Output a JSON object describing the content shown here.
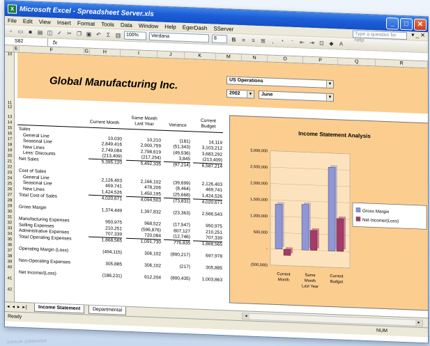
{
  "window": {
    "title": "Microsoft Excel - Spreadsheet Server.xls",
    "app_icon": "excel-icon",
    "btn_min": "_",
    "btn_max": "□",
    "btn_close": "✕"
  },
  "menu": {
    "items": [
      "File",
      "Edit",
      "View",
      "Insert",
      "Format",
      "Tools",
      "Data",
      "Window",
      "Help",
      "EgerDash",
      "SServer"
    ],
    "help_placeholder": "Type a question for help",
    "doc_close": "▾ _ ✕"
  },
  "toolbar": {
    "zoom": "100%",
    "font": "Verdana",
    "font_size": "8",
    "bold": "B"
  },
  "formula_bar": {
    "name_box": "S82",
    "fx": "fx"
  },
  "columns": [
    "E",
    "F",
    "G",
    "H",
    "I",
    "J",
    "K",
    "M",
    "N",
    "O",
    "P",
    "Q",
    "R"
  ],
  "rows": [
    "10",
    "11",
    "12",
    "13",
    "14",
    "15",
    "16",
    "17",
    "18",
    "19",
    "20",
    "21",
    "22",
    "23",
    "24",
    "25",
    "26",
    "27",
    "28",
    "29",
    "30",
    "31",
    "32",
    "33",
    "34",
    "35",
    "36",
    "37",
    "38",
    "39",
    "40",
    "41",
    "42"
  ],
  "header": {
    "company": "Global Manufacturing Inc.",
    "region": "US Operations",
    "year": "2002",
    "month": "June"
  },
  "table": {
    "headers": {
      "current_month": "Current Month",
      "same_month": "Same Month",
      "last_year": "Last Year",
      "variance": "Variance",
      "current": "Current",
      "budget": "Budget"
    },
    "rows": [
      {
        "label": "Sales",
        "indent": false,
        "v": [
          "",
          "",
          "",
          ""
        ],
        "ul": false
      },
      {
        "label": "General Line",
        "indent": true,
        "v": [
          "10,030",
          "10,210",
          "(181)",
          "14,119"
        ],
        "ul": false
      },
      {
        "label": "Seasonal Line",
        "indent": true,
        "v": [
          "2,849,416",
          "2,900,759",
          "(51,343)",
          "3,103,212"
        ],
        "ul": false
      },
      {
        "label": "New Lines",
        "indent": true,
        "v": [
          "2,749,084",
          "2,798,619",
          "(49,536)",
          "3,683,292"
        ],
        "ul": false
      },
      {
        "label": "Less: Discounts",
        "indent": true,
        "v": [
          "(213,409)",
          "(217,254)",
          "3,845",
          "(213,409)"
        ],
        "ul": true
      },
      {
        "label": "Net Sales",
        "indent": false,
        "v": [
          "5,395,120",
          "5,492,335",
          "(97,214)",
          "6,587,214"
        ],
        "ul": false
      },
      {
        "label": "",
        "indent": false,
        "v": [
          "",
          "",
          "",
          ""
        ],
        "ul": false
      },
      {
        "label": "Cost of Sales",
        "indent": false,
        "v": [
          "",
          "",
          "",
          ""
        ],
        "ul": false
      },
      {
        "label": "General Line",
        "indent": true,
        "v": [
          "2,126,403",
          "2,166,102",
          "(39,699)",
          "2,126,403"
        ],
        "ul": false
      },
      {
        "label": "Seasonal Line",
        "indent": true,
        "v": [
          "469,741",
          "478,206",
          "(8,464)",
          "469,741"
        ],
        "ul": false
      },
      {
        "label": "New Lines",
        "indent": true,
        "v": [
          "1,424,526",
          "1,450,195",
          "(25,668)",
          "1,424,526"
        ],
        "ul": true
      },
      {
        "label": "Total Cost of Sales",
        "indent": false,
        "v": [
          "4,020,671",
          "4,094,503",
          "(73,831)",
          "4,020,671"
        ],
        "ul": false
      },
      {
        "label": "",
        "indent": false,
        "v": [
          "",
          "",
          "",
          ""
        ],
        "ul": false
      },
      {
        "label": "Gross Margin",
        "indent": false,
        "v": [
          "1,374,449",
          "1,397,832",
          "(23,363)",
          "2,566,543"
        ],
        "ul": false
      },
      {
        "label": "",
        "indent": false,
        "v": [
          "",
          "",
          "",
          ""
        ],
        "ul": false
      },
      {
        "label": "Manufacturing Expenses",
        "indent": false,
        "v": [
          "950,975",
          "968,522",
          "(17,547)",
          "950,975"
        ],
        "ul": false
      },
      {
        "label": "Selling Expenses",
        "indent": false,
        "v": [
          "210,251",
          "(596,876)",
          "807,127",
          "210,251"
        ],
        "ul": false
      },
      {
        "label": "Administrative Expenses",
        "indent": false,
        "v": [
          "707,339",
          "720,084",
          "(12,746)",
          "707,339"
        ],
        "ul": true
      },
      {
        "label": "Total Operating Expenses",
        "indent": false,
        "v": [
          "1,868,565",
          "1,091,730",
          "776,835",
          "1,868,565"
        ],
        "ul": false
      },
      {
        "label": "",
        "indent": false,
        "v": [
          "",
          "",
          "",
          ""
        ],
        "ul": false
      },
      {
        "label": "Operating Margin (Loss)",
        "indent": false,
        "v": [
          "(494,115)",
          "306,102",
          "(800,217)",
          "697,978"
        ],
        "ul": false
      },
      {
        "label": "",
        "indent": false,
        "v": [
          "",
          "",
          "",
          ""
        ],
        "ul": false
      },
      {
        "label": "Non-Operating Expenses",
        "indent": false,
        "v": [
          "305,885",
          "306,102",
          "(217)",
          "305,885"
        ],
        "ul": false
      },
      {
        "label": "",
        "indent": false,
        "v": [
          "",
          "",
          "",
          ""
        ],
        "ul": false
      },
      {
        "label": "Net Income/(Loss)",
        "indent": false,
        "v": [
          "(188,231)",
          "612,204",
          "(800,435)",
          "1,003,863"
        ],
        "ul": false
      }
    ]
  },
  "chart_data": {
    "type": "bar",
    "title": "Income Statement Analysis",
    "categories": [
      [
        "Current",
        "Month"
      ],
      [
        "Same",
        "Month",
        "Last Year"
      ],
      [
        "Current",
        "Budget"
      ]
    ],
    "series": [
      {
        "name": "Gross Margin",
        "color": "#8f97d8",
        "values": [
          1374449,
          1397832,
          2566543
        ]
      },
      {
        "name": "Net Income/(Loss)",
        "color": "#a33a6a",
        "values": [
          -188231,
          612204,
          1003863
        ]
      }
    ],
    "ylim": [
      -500000,
      3000000
    ],
    "yticks": [
      "(500,000)",
      "-",
      "500,000",
      "1,000,000",
      "1,500,000",
      "2,000,000",
      "2,500,000",
      "3,000,000"
    ],
    "ytick_values": [
      -500000,
      0,
      500000,
      1000000,
      1500000,
      2000000,
      2500000,
      3000000
    ],
    "legend_position": "right",
    "background": "#fbcd8f"
  },
  "tabs": {
    "nav": "◂ ◂ ▸ ▸|",
    "items": [
      "Income Statement",
      "Departmental"
    ],
    "active": 0
  },
  "status": {
    "ready": "Ready",
    "num": "NUM"
  }
}
